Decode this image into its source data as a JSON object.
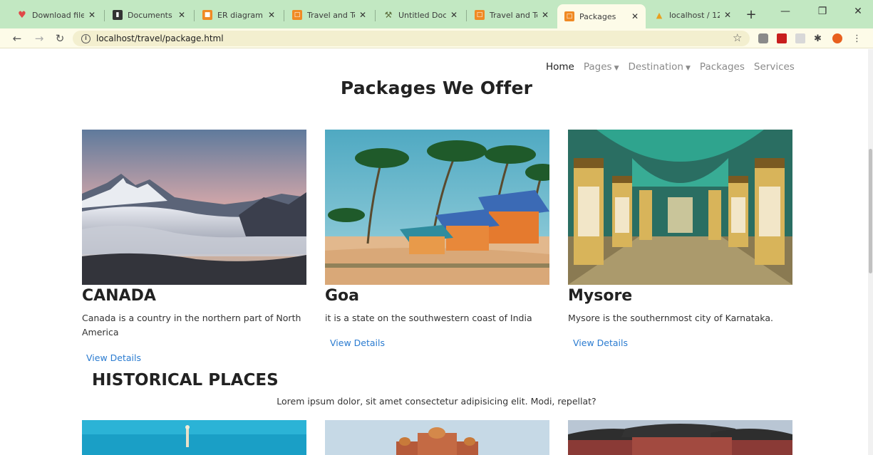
{
  "browser": {
    "tabs": [
      {
        "label": "Download file",
        "icon": "heart-icon",
        "color": "#e04848"
      },
      {
        "label": "Documents",
        "icon": "document-icon",
        "color": "#333333"
      },
      {
        "label": "ER diagram tra",
        "icon": "diagram-icon",
        "color": "#f08a24"
      },
      {
        "label": "Travel and Tou",
        "icon": "travel-icon",
        "color": "#f08a24"
      },
      {
        "label": "Untitled Docu",
        "icon": "tool-icon",
        "color": "#5a6b3a"
      },
      {
        "label": "Travel and Tou",
        "icon": "travel-icon",
        "color": "#f08a24"
      },
      {
        "label": "Packages",
        "icon": "travel-icon",
        "color": "#f08a24"
      },
      {
        "label": "localhost / 12",
        "icon": "phpmyadmin-icon",
        "color": "#e8a020"
      }
    ],
    "active_tab": 6,
    "url": "localhost/travel/package.html"
  },
  "nav": {
    "home": "Home",
    "pages": "Pages",
    "destination": "Destination",
    "packages": "Packages",
    "services": "Services"
  },
  "main": {
    "title": "Packages We Offer",
    "cards": [
      {
        "title": "CANADA",
        "description": "Canada is a country in the northern part of North America",
        "link": "View Details"
      },
      {
        "title": "Goa",
        "description": "it is a state on the southwestern coast of India",
        "link": "View Details"
      },
      {
        "title": "Mysore",
        "description": "Mysore is the southernmost city of Karnataka.",
        "link": "View Details"
      }
    ]
  },
  "historical": {
    "title": "HISTORICAL PLACES",
    "subtitle": "Lorem ipsum dolor, sit amet consectetur adipisicing elit. Modi, repellat?"
  }
}
